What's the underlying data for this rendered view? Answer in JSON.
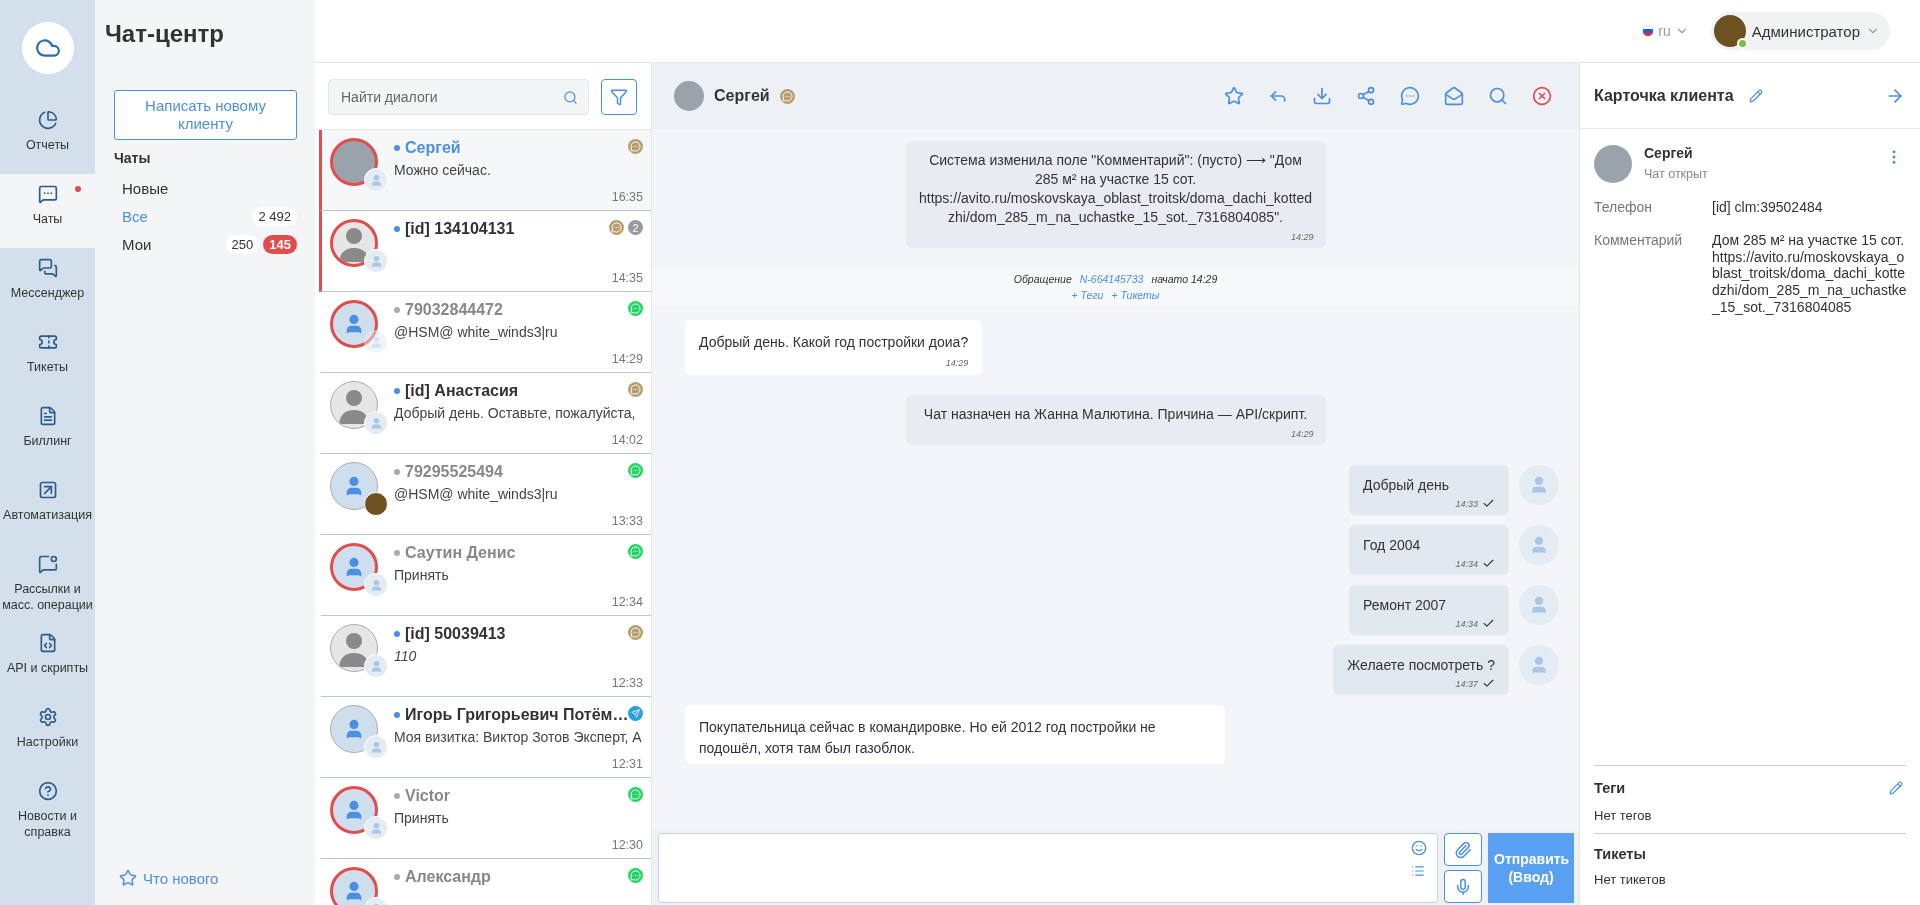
{
  "nav": {
    "items": [
      {
        "label": "Отчеты",
        "selected": false,
        "dot": false
      },
      {
        "label": "Чаты",
        "selected": true,
        "dot": true
      },
      {
        "label": "Мессенджер",
        "selected": false,
        "dot": false
      },
      {
        "label": "Тикеты",
        "selected": false,
        "dot": false
      },
      {
        "label": "Биллинг",
        "selected": false,
        "dot": false
      },
      {
        "label": "Автоматизация",
        "selected": false,
        "dot": false
      },
      {
        "label": "Рассылки и масс. операции",
        "selected": false,
        "dot": false
      },
      {
        "label": "API и скрипты",
        "selected": false,
        "dot": false
      },
      {
        "label": "Настройки",
        "selected": false,
        "dot": false
      },
      {
        "label": "Новости и справка",
        "selected": false,
        "dot": false
      }
    ]
  },
  "filters": {
    "title": "Чат-центр",
    "new_button": "Написать новому клиенту",
    "section": "Чаты",
    "items": [
      {
        "label": "Новые",
        "selected": false
      },
      {
        "label": "Все",
        "selected": true,
        "count": "2 492"
      },
      {
        "label": "Мои",
        "selected": false,
        "count": "250",
        "badge": "145"
      }
    ],
    "whats_new": "Что нового"
  },
  "topbar": {
    "language": "ru",
    "user": "Администратор",
    "online": true
  },
  "chat_list": {
    "search_placeholder": "Найти диалоги",
    "items": [
      {
        "name": "Сергей",
        "preview": "Можно сейчас.",
        "time": "16:35",
        "online": true,
        "selected": true,
        "alert": true,
        "flagged": true,
        "avatar": {
          "kind": "photo"
        },
        "operator": {
          "kind": "default"
        },
        "channel": {
          "kind": "chat"
        }
      },
      {
        "name": "[id] 134104131",
        "time": "14:35",
        "online": true,
        "selected": false,
        "alert": true,
        "flagged": true,
        "avatar": {
          "kind": "silhouette"
        },
        "operator": {
          "kind": "default"
        },
        "channel": {
          "kind": "chat"
        },
        "unread": "2"
      },
      {
        "name": "79032844472",
        "preview": "@HSM@ white_winds3|ru",
        "time": "14:29",
        "online": false,
        "selected": false,
        "alert": true,
        "flagged": false,
        "avatar": {
          "kind": "default"
        },
        "operator": {
          "kind": "faded"
        },
        "channel": {
          "kind": "whatsapp"
        }
      },
      {
        "name": "[id] Анастасия",
        "preview": "Добрый день. Оставьте, пожалуйста,",
        "time": "14:02",
        "online": true,
        "selected": false,
        "alert": false,
        "flagged": false,
        "avatar": {
          "kind": "silhouette"
        },
        "operator": {
          "kind": "default"
        },
        "channel": {
          "kind": "chat"
        }
      },
      {
        "name": "79295525494",
        "preview": "@HSM@ white_winds3|ru",
        "time": "13:33",
        "online": false,
        "selected": false,
        "alert": false,
        "flagged": false,
        "avatar": {
          "kind": "default"
        },
        "operator": {
          "kind": "logo"
        },
        "channel": {
          "kind": "whatsapp"
        }
      },
      {
        "name": "Саутин Денис",
        "preview": "Принять",
        "time": "12:34",
        "online": false,
        "selected": false,
        "alert": true,
        "flagged": false,
        "avatar": {
          "kind": "default"
        },
        "operator": {
          "kind": "default"
        },
        "channel": {
          "kind": "whatsapp"
        }
      },
      {
        "name": "[id] 50039413",
        "preview": "110",
        "italic": true,
        "time": "12:33",
        "online": true,
        "selected": false,
        "alert": false,
        "flagged": false,
        "avatar": {
          "kind": "silhouette"
        },
        "operator": {
          "kind": "default"
        },
        "channel": {
          "kind": "chat"
        }
      },
      {
        "name": "Игорь Григорьевич Потём…",
        "preview": "Моя визитка: Виктор Зотов Эксперт, А",
        "time": "12:31",
        "online": true,
        "selected": false,
        "alert": false,
        "flagged": false,
        "avatar": {
          "kind": "default"
        },
        "operator": {
          "kind": "default"
        },
        "channel": {
          "kind": "telegram"
        }
      },
      {
        "name": "Victor",
        "preview": "Принять",
        "time": "12:30",
        "online": false,
        "selected": false,
        "alert": true,
        "flagged": false,
        "avatar": {
          "kind": "default"
        },
        "operator": {
          "kind": "default"
        },
        "channel": {
          "kind": "whatsapp"
        }
      },
      {
        "name": "Александр",
        "online": false,
        "selected": false,
        "alert": true,
        "flagged": false,
        "avatar": {
          "kind": "default"
        },
        "operator": {
          "kind": "default"
        },
        "channel": {
          "kind": "whatsapp"
        }
      }
    ]
  },
  "chat": {
    "name": "Сергей",
    "messages": [
      {
        "kind": "system",
        "text": "Система изменила поле \"Комментарий\": (пусто) ⟶ \"Дом 285 м² на участке 15 сот. https://avito.ru/moskovskaya_oblast_troitsk/doma_dachi_kottedzhi/dom_285_m_na_uchastke_15_sot._7316804085\".",
        "time": "14:29"
      },
      {
        "kind": "session",
        "label": "Обращение",
        "ticket": "N-664145733",
        "started": "начато 14:29",
        "tags_link": "+ Теги",
        "tickets_link": "+ Тикеты"
      },
      {
        "kind": "incoming",
        "text": "Добрый день. Какой год постройки доиа?",
        "time": "14:29"
      },
      {
        "kind": "system",
        "text": "Чат назначен на Жанна Малютина. Причина — API/скрипт.",
        "time": "14:29"
      },
      {
        "kind": "outgoing",
        "text": "Добрый день",
        "time": "14:33",
        "delivered": true
      },
      {
        "kind": "outgoing",
        "text": "Год 2004",
        "time": "14:34",
        "delivered": true
      },
      {
        "kind": "outgoing",
        "text": "Ремонт 2007",
        "time": "14:34",
        "delivered": true
      },
      {
        "kind": "outgoing",
        "text": "Желаете посмотреть ?",
        "time": "14:37",
        "delivered": true
      },
      {
        "kind": "incoming",
        "text": "Покупательница сейчас в командировке. Но ей 2012 год постройки не подошёл, хотя там был газоблок."
      }
    ],
    "send_button": "Отправить (Ввод)"
  },
  "client_card": {
    "title": "Карточка клиента",
    "name": "Сергей",
    "status": "Чат открыт",
    "fields": [
      {
        "label": "Телефон",
        "value": "[id] clm:39502484"
      },
      {
        "label": "Комментарий",
        "value": "Дом 285 м² на участке 15 сот. https://avito.ru/moskovskaya_oblast_troitsk/doma_dachi_kottedzhi/dom_285_m_na_uchastke_15_sot._7316804085"
      }
    ],
    "tags_title": "Теги",
    "tags_empty": "Нет тегов",
    "tickets_title": "Тикеты",
    "tickets_empty": "Нет тикетов"
  }
}
